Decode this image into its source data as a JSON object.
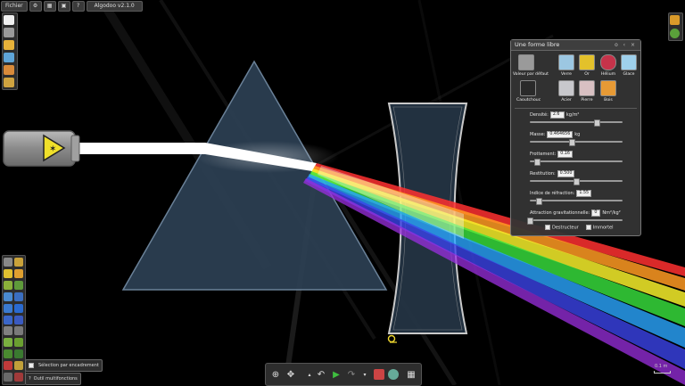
{
  "menu": {
    "file_label": "Fichier",
    "app_title": "Algodoo v2.1.0"
  },
  "panel": {
    "title": "Une forme libre",
    "controls": "o ‹ ×",
    "materials": [
      {
        "label": "Valeur par défaut",
        "color": "#9a9a9a"
      },
      {
        "label": "Verre",
        "color": "#9cc7e2"
      },
      {
        "label": "Or",
        "color": "#e3c12b"
      },
      {
        "label": "Hélium",
        "color": "#c6334a"
      },
      {
        "label": "Glace",
        "color": "#9fd1ec"
      },
      {
        "label": "Caoutchouc",
        "color": "#2a2a2a"
      },
      {
        "label": "Acier",
        "color": "#c8c8cc"
      },
      {
        "label": "Pierre",
        "color": "#d8c0c2"
      },
      {
        "label": "Bois",
        "color": "#e79a35"
      }
    ],
    "properties": [
      {
        "label": "Densité:",
        "value": "2.6",
        "unit": "kg/m²",
        "level": 0.72
      },
      {
        "label": "Masse:",
        "value": "0.464656",
        "unit": "kg",
        "level": 0.45
      },
      {
        "label": "Frottement:",
        "value": "0.16",
        "unit": "",
        "level": 0.08
      },
      {
        "label": "Restitution:",
        "value": "0.500",
        "unit": "",
        "level": 0.5
      },
      {
        "label": "Indice de réfraction:",
        "value": "1.55",
        "unit": "",
        "level": 0.1
      },
      {
        "label": "Attraction gravitationnelle:",
        "value": "0",
        "unit": "Nm²/kg²",
        "level": 0.0
      }
    ],
    "destructeur_label": "Destructeur",
    "immortel_label": "Immortel"
  },
  "tooltips": {
    "selection": "Sélection par encadrement",
    "multitool": "Outil multifonctions"
  },
  "scale_label": "0.1 m",
  "colors": {
    "background": "#000000",
    "prism_fill": "#2c4054",
    "lens_fill": "#243443",
    "laser_body": "#8e8e8e",
    "laser_icon": "#f0e02a",
    "beam": "#ffffff"
  },
  "icons": {
    "laser": "laser-warning-icon",
    "lens_anchor": "pin-icon",
    "zoom": "zoom-icon",
    "pan": "pan-icon",
    "undo": "undo-icon",
    "play": "play-icon",
    "redo": "redo-icon"
  }
}
